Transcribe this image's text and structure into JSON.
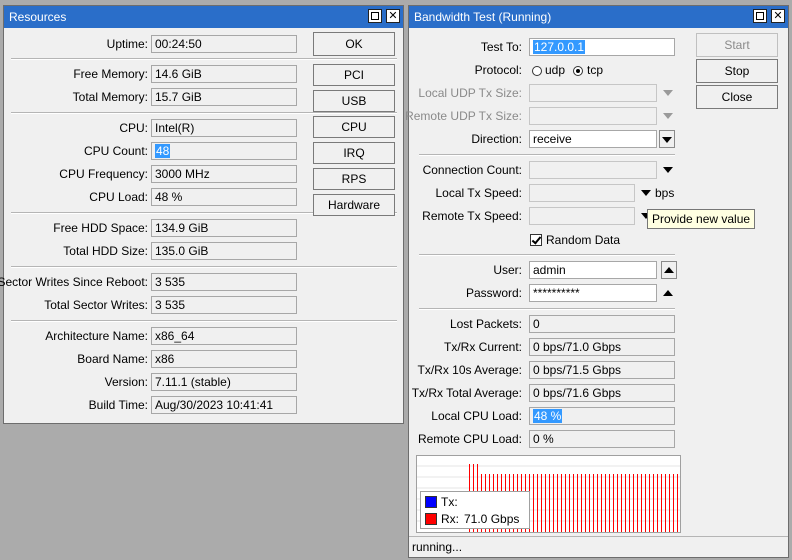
{
  "resources": {
    "title": "Resources",
    "rows": [
      {
        "label": "Uptime:",
        "value": "00:24:50"
      },
      {
        "label": "Free Memory:",
        "value": "14.6 GiB"
      },
      {
        "label": "Total Memory:",
        "value": "15.7 GiB"
      },
      {
        "label": "CPU:",
        "value": "Intel(R)"
      },
      {
        "label": "CPU Count:",
        "value": "48"
      },
      {
        "label": "CPU Frequency:",
        "value": "3000 MHz"
      },
      {
        "label": "CPU Load:",
        "value": "48 %"
      },
      {
        "label": "Free HDD Space:",
        "value": "134.9 GiB"
      },
      {
        "label": "Total HDD Size:",
        "value": "135.0 GiB"
      },
      {
        "label": "Sector Writes Since Reboot:",
        "value": "3 535"
      },
      {
        "label": "Total Sector Writes:",
        "value": "3 535"
      },
      {
        "label": "Architecture Name:",
        "value": "x86_64"
      },
      {
        "label": "Board Name:",
        "value": "x86"
      },
      {
        "label": "Version:",
        "value": "7.11.1 (stable)"
      },
      {
        "label": "Build Time:",
        "value": "Aug/30/2023 10:41:41"
      }
    ],
    "buttons": {
      "ok": "OK",
      "pci": "PCI",
      "usb": "USB",
      "cpu": "CPU",
      "irq": "IRQ",
      "rps": "RPS",
      "hardware": "Hardware"
    }
  },
  "bandwidth": {
    "title": "Bandwidth Test (Running)",
    "test_to_label": "Test To:",
    "test_to": "127.0.0.1",
    "protocol_label": "Protocol:",
    "udp": "udp",
    "tcp": "tcp",
    "local_udp_label": "Local UDP Tx Size:",
    "remote_udp_label": "Remote UDP Tx Size:",
    "direction_label": "Direction:",
    "direction": "receive",
    "conn_count_label": "Connection Count:",
    "local_tx_label": "Local Tx Speed:",
    "bps": "bps",
    "remote_tx_label": "Remote Tx Speed:",
    "tooltip": "Provide new value",
    "random_data": "Random Data",
    "user_label": "User:",
    "user": "admin",
    "password_label": "Password:",
    "password": "**********",
    "lost_label": "Lost Packets:",
    "lost": "0",
    "current_label": "Tx/Rx Current:",
    "current": "0 bps/71.0 Gbps",
    "avg10_label": "Tx/Rx 10s Average:",
    "avg10": "0 bps/71.5 Gbps",
    "total_label": "Tx/Rx Total Average:",
    "total": "0 bps/71.6 Gbps",
    "local_cpu_label": "Local CPU Load:",
    "local_cpu": "48 %",
    "remote_cpu_label": "Remote CPU Load:",
    "remote_cpu": "0 %",
    "buttons": {
      "start": "Start",
      "stop": "Stop",
      "close": "Close"
    },
    "legend": {
      "tx_label": "Tx:",
      "tx_value": "",
      "rx_label": "Rx:",
      "rx_value": "71.0 Gbps",
      "tx_color": "#0000ff",
      "rx_color": "#ff0000"
    },
    "status": "running..."
  }
}
